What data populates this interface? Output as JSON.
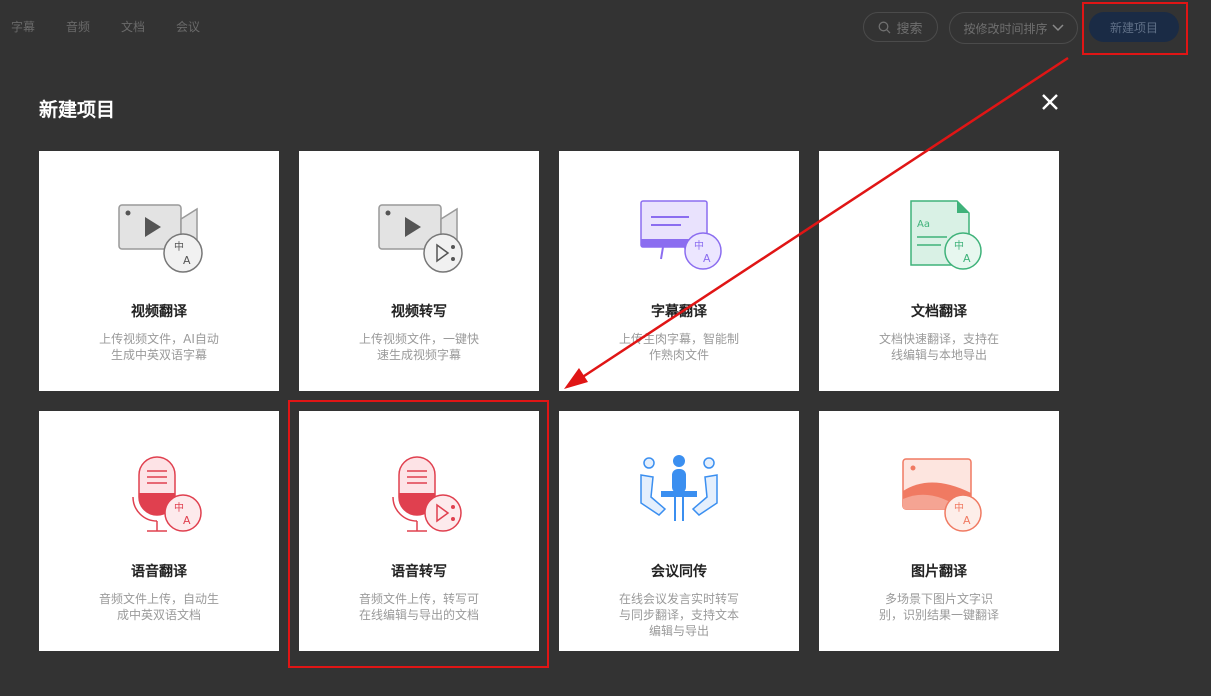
{
  "nav": {
    "tabs": [
      "字幕",
      "音频",
      "文档",
      "会议"
    ]
  },
  "toolbar": {
    "search_label": "搜索",
    "sort_label": "按修改时间排序",
    "new_project_label": "新建项目"
  },
  "dialog": {
    "title": "新建项目"
  },
  "cards": [
    {
      "title": "视频翻译",
      "desc": "上传视频文件，AI自动生成中英双语字幕",
      "icon": "video-translate-icon"
    },
    {
      "title": "视频转写",
      "desc": "上传视频文件，一键快速生成视频字幕",
      "icon": "video-transcribe-icon"
    },
    {
      "title": "字幕翻译",
      "desc": "上传生肉字幕，智能制作熟肉文件",
      "icon": "subtitle-translate-icon"
    },
    {
      "title": "文档翻译",
      "desc": "文档快速翻译，支持在线编辑与本地导出",
      "icon": "document-translate-icon"
    },
    {
      "title": "语音翻译",
      "desc": "音频文件上传，自动生成中英双语文档",
      "icon": "voice-translate-icon"
    },
    {
      "title": "语音转写",
      "desc": "音频文件上传，转写可在线编辑与导出的文档",
      "icon": "voice-transcribe-icon"
    },
    {
      "title": "会议同传",
      "desc": "在线会议发言实时转写与同步翻译，支持文本编辑与导出",
      "icon": "meeting-interpret-icon"
    },
    {
      "title": "图片翻译",
      "desc": "多场景下图片文字识别，识别结果一键翻译",
      "icon": "image-translate-icon"
    }
  ],
  "colors": {
    "background": "#333333",
    "card": "#ffffff",
    "highlight": "#e01515",
    "new_button": "#1a2b45",
    "purple": "#8b6df0",
    "green": "#3fb27a",
    "red": "#e0404f",
    "blue": "#3b8ff0",
    "coral": "#f07a62"
  }
}
